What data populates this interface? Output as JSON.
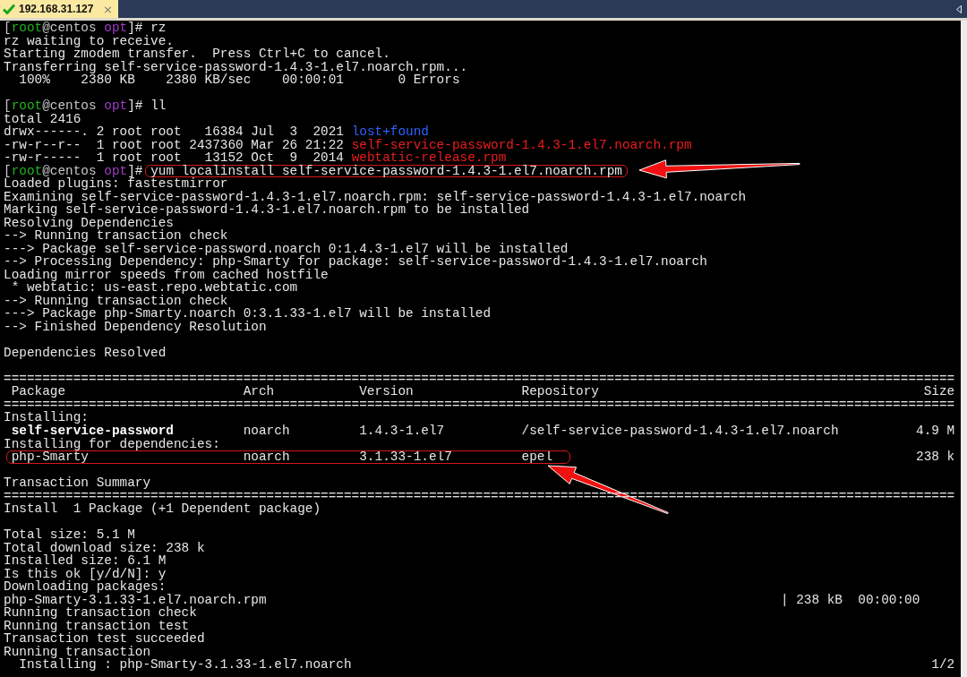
{
  "tab": {
    "title": "192.168.31.127",
    "close": "×",
    "connected": true
  },
  "lines": [
    {
      "kind": "prompt",
      "prompt": [
        {
          "text": "[",
          "color": "#c8c8c8"
        },
        {
          "text": "root",
          "color": "#22b422"
        },
        {
          "text": "@centos ",
          "color": "#c8c8c8"
        },
        {
          "text": "opt",
          "color": "#a23bc8"
        },
        {
          "text": "]#",
          "color": "#e8e8e8"
        }
      ],
      "command": "rz",
      "highlighted": false
    },
    {
      "kind": "text",
      "text": "rz waiting to receive."
    },
    {
      "kind": "text",
      "text": "Starting zmodem transfer.  Press Ctrl+C to cancel."
    },
    {
      "kind": "text",
      "text": "Transferring self-service-password-1.4.3-1.el7.noarch.rpm..."
    },
    {
      "kind": "text",
      "text": "  100%    2380 KB    2380 KB/sec    00:00:01       0 Errors"
    },
    {
      "kind": "blank"
    },
    {
      "kind": "prompt",
      "prompt": [
        {
          "text": "[",
          "color": "#c8c8c8"
        },
        {
          "text": "root",
          "color": "#22b422"
        },
        {
          "text": "@centos ",
          "color": "#c8c8c8"
        },
        {
          "text": "opt",
          "color": "#a23bc8"
        },
        {
          "text": "]#",
          "color": "#e8e8e8"
        }
      ],
      "command": "ll",
      "highlighted": false
    },
    {
      "kind": "text",
      "text": "total 2416"
    },
    {
      "kind": "listing",
      "text": "drwx------. 2 root root   16384 Jul  3  2021",
      "name": "lost+found",
      "color": "#2f62ff"
    },
    {
      "kind": "listing",
      "text": "-rw-r--r--  1 root root 2437360 Mar 26 21:22",
      "name": "self-service-password-1.4.3-1.el7.noarch.rpm",
      "color": "#ee1c1c"
    },
    {
      "kind": "listing",
      "text": "-rw-r-----  1 root root   13152 Oct  9  2014",
      "name": "webtatic-release.rpm",
      "color": "#ee1c1c"
    },
    {
      "kind": "prompt",
      "prompt": [
        {
          "text": "[",
          "color": "#c8c8c8"
        },
        {
          "text": "root",
          "color": "#22b422"
        },
        {
          "text": "@centos ",
          "color": "#c8c8c8"
        },
        {
          "text": "opt",
          "color": "#a23bc8"
        },
        {
          "text": "]#",
          "color": "#e8e8e8"
        }
      ],
      "command": "yum localinstall self-service-password-1.4.3-1.el7.noarch.rpm",
      "highlighted": true
    },
    {
      "kind": "text",
      "text": "Loaded plugins: fastestmirror"
    },
    {
      "kind": "text",
      "text": "Examining self-service-password-1.4.3-1.el7.noarch.rpm: self-service-password-1.4.3-1.el7.noarch"
    },
    {
      "kind": "text",
      "text": "Marking self-service-password-1.4.3-1.el7.noarch.rpm to be installed"
    },
    {
      "kind": "text",
      "text": "Resolving Dependencies"
    },
    {
      "kind": "text",
      "text": "--> Running transaction check"
    },
    {
      "kind": "text",
      "text": "---> Package self-service-password.noarch 0:1.4.3-1.el7 will be installed"
    },
    {
      "kind": "text",
      "text": "--> Processing Dependency: php-Smarty for package: self-service-password-1.4.3-1.el7.noarch"
    },
    {
      "kind": "text",
      "text": "Loading mirror speeds from cached hostfile"
    },
    {
      "kind": "text",
      "text": " * webtatic: us-east.repo.webtatic.com"
    },
    {
      "kind": "text",
      "text": "--> Running transaction check"
    },
    {
      "kind": "text",
      "text": "---> Package php-Smarty.noarch 0:3.1.33-1.el7 will be installed"
    },
    {
      "kind": "text",
      "text": "--> Finished Dependency Resolution"
    },
    {
      "kind": "blank"
    },
    {
      "kind": "text",
      "text": "Dependencies Resolved"
    },
    {
      "kind": "blank"
    },
    {
      "kind": "rule",
      "text": "==========================================================================================================================="
    },
    {
      "kind": "table-header",
      "cells": [
        "Package",
        "Arch",
        "Version",
        "Repository",
        "Size"
      ]
    },
    {
      "kind": "rule",
      "text": "==========================================================================================================================="
    },
    {
      "kind": "text",
      "text": "Installing:"
    },
    {
      "kind": "table-row",
      "cells": [
        "self-service-password",
        "noarch",
        "1.4.3-1.el7",
        "/self-service-password-1.4.3-1.el7.noarch",
        "4.9 M"
      ],
      "bold": true,
      "highlighted": false
    },
    {
      "kind": "text",
      "text": "Installing for dependencies:"
    },
    {
      "kind": "table-row",
      "cells": [
        "php-Smarty",
        "noarch",
        "3.1.33-1.el7",
        "epel",
        "238 k"
      ],
      "bold": false,
      "highlighted": true
    },
    {
      "kind": "blank"
    },
    {
      "kind": "text",
      "text": "Transaction Summary"
    },
    {
      "kind": "rule",
      "text": "==========================================================================================================================="
    },
    {
      "kind": "text",
      "text": "Install  1 Package (+1 Dependent package)"
    },
    {
      "kind": "blank"
    },
    {
      "kind": "text",
      "text": "Total size: 5.1 M"
    },
    {
      "kind": "text",
      "text": "Total download size: 238 k"
    },
    {
      "kind": "text",
      "text": "Installed size: 6.1 M"
    },
    {
      "kind": "text",
      "text": "Is this ok [y/d/N]: y"
    },
    {
      "kind": "text",
      "text": "Downloading packages:"
    },
    {
      "kind": "download",
      "file": "php-Smarty-3.1.33-1.el7.noarch.rpm",
      "stats": "| 238 kB  00:00:00"
    },
    {
      "kind": "text",
      "text": "Running transaction check"
    },
    {
      "kind": "text",
      "text": "Running transaction test"
    },
    {
      "kind": "text",
      "text": "Transaction test succeeded"
    },
    {
      "kind": "text",
      "text": "Running transaction"
    },
    {
      "kind": "step",
      "text": "  Installing : php-Smarty-3.1.33-1.el7.noarch",
      "count": "1/2"
    }
  ]
}
